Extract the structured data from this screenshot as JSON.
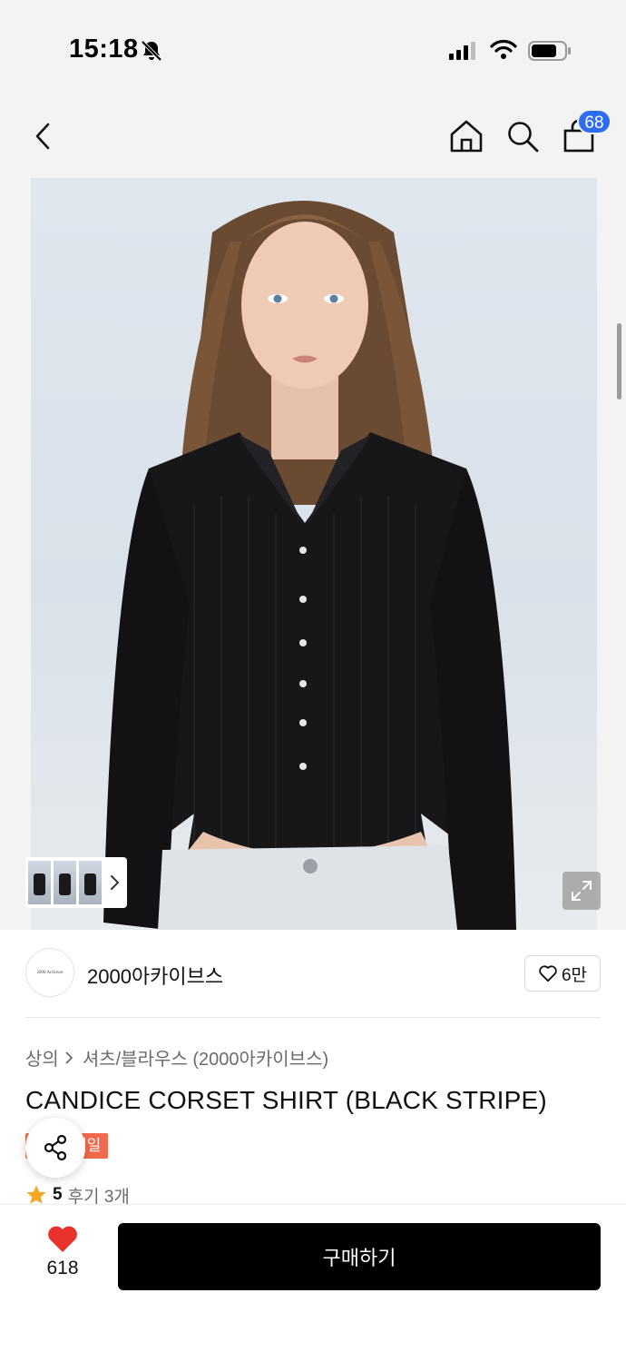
{
  "status_bar": {
    "time": "15:18",
    "icons": [
      "bell-slash-icon",
      "signal-icon",
      "wifi-icon",
      "battery-icon"
    ]
  },
  "top_nav": {
    "icons": [
      "chevron-left-icon",
      "home-icon",
      "search-icon",
      "cart-icon"
    ],
    "cart_count": "68"
  },
  "hero": {
    "image_description": "product-photo",
    "thumbnail_count": 3,
    "icons": [
      "chevron-right-icon",
      "expand-icon"
    ]
  },
  "brand": {
    "name": "2000아카이브스",
    "avatar_text": "2000 Archives",
    "likes": "6만",
    "like_icon": "heart-outline-icon"
  },
  "product": {
    "breadcrumb": [
      "상의",
      "셔츠/블라우스 (2000아카이브스)"
    ],
    "title": "CANDICE CORSET SHIRT (BLACK STRIPE)",
    "badge": "세일",
    "rating": "5",
    "review_label": "후기 3개",
    "share_icon": "share-icon",
    "star_color": "#f5a623"
  },
  "bottom_bar": {
    "wish_count": "618",
    "buy_label": "구매하기",
    "heart_color": "#e8322b"
  },
  "colors": {
    "accent_blue": "#2f6df0",
    "sale_orange": "#f26a4b",
    "buy_button": "#000000"
  }
}
